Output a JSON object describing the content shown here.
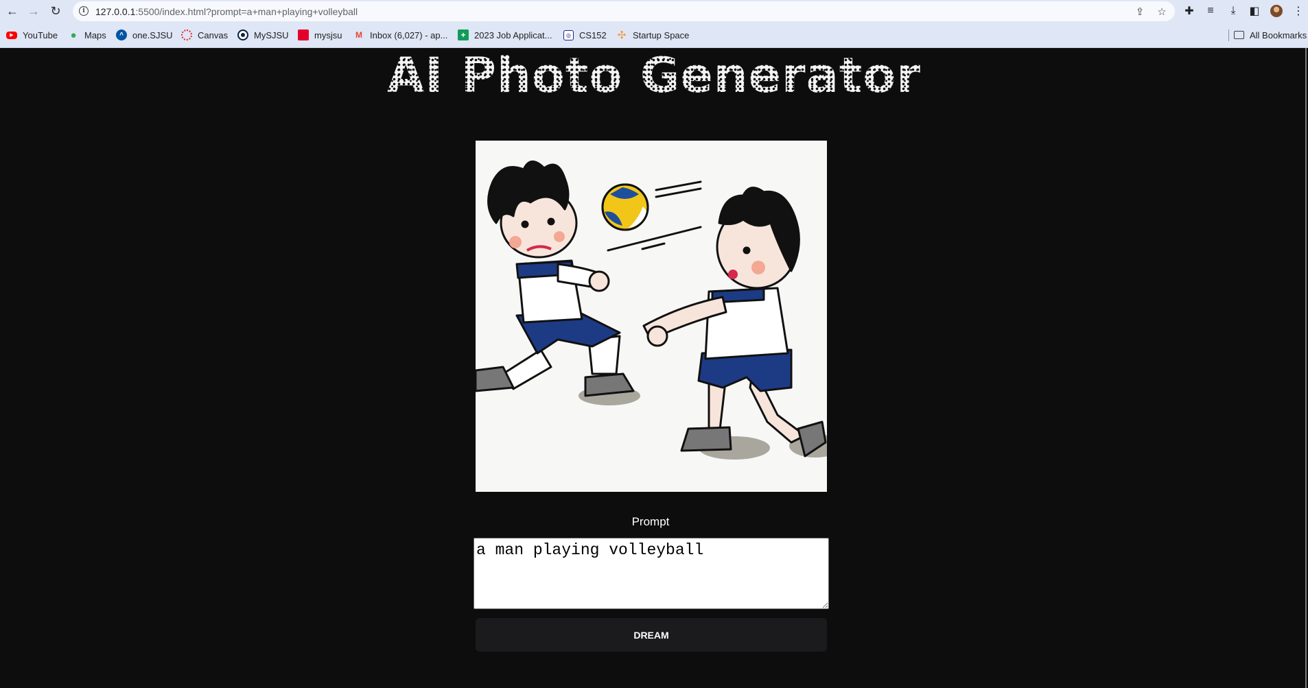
{
  "browser": {
    "url_host": "127.0.0.1",
    "url_path": ":5500/index.html?prompt=a+man+playing+volleyball",
    "bookmarks": [
      {
        "label": "YouTube",
        "icon": "youtube-icon",
        "color": "#ff0000"
      },
      {
        "label": "Maps",
        "icon": "maps-pin-icon",
        "color": "#34a853"
      },
      {
        "label": "one.SJSU",
        "icon": "sjsu-icon",
        "color": "#0055a2"
      },
      {
        "label": "Canvas",
        "icon": "canvas-icon",
        "color": "#e72429"
      },
      {
        "label": "MySJSU",
        "icon": "mysjsu-icon",
        "color": "#0c2340"
      },
      {
        "label": "mysjsu",
        "icon": "mysjsu-red-icon",
        "color": "#e4002b"
      },
      {
        "label": "Inbox (6,027) - ap...",
        "icon": "gmail-icon",
        "color": "#ea4335"
      },
      {
        "label": "2023 Job Applicat...",
        "icon": "sheets-icon",
        "color": "#0f9d58"
      },
      {
        "label": "CS152",
        "icon": "cs152-icon",
        "color": "#1a237e"
      },
      {
        "label": "Startup Space",
        "icon": "startup-icon",
        "color": "#f29a38"
      }
    ],
    "all_bookmarks": "All Bookmarks"
  },
  "page": {
    "title": "AI Photo Generator",
    "image_alt": "a man playing volleyball",
    "prompt_label": "Prompt",
    "prompt_value": "a man playing volleyball",
    "button_label": "DREAM"
  },
  "colors": {
    "page_bg": "#0d0d0e",
    "button_bg": "#1b1b1d",
    "chrome_bg": "#dfe6f5"
  }
}
